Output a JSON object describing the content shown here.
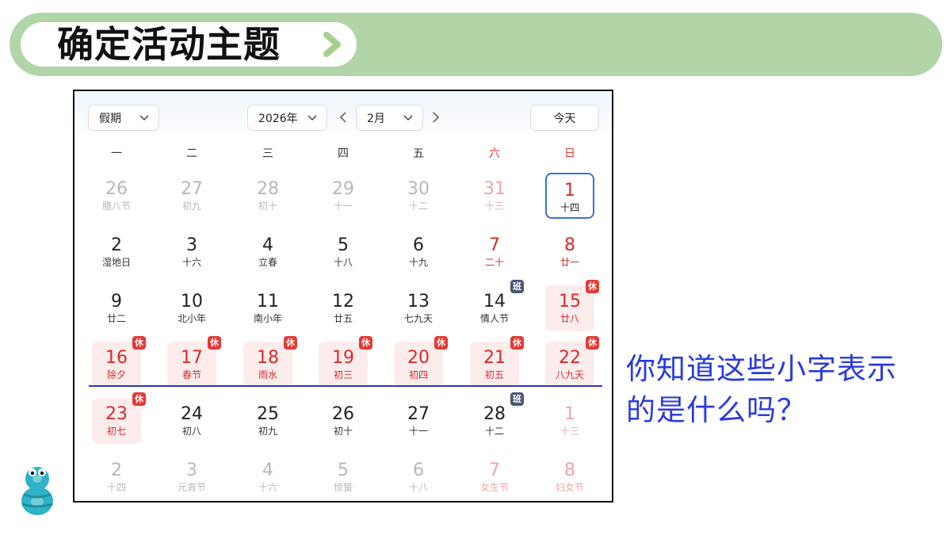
{
  "header": {
    "title": "确定活动主题"
  },
  "calendar": {
    "controls": {
      "holiday_label": "假期",
      "year_label": "2026年",
      "month_label": "2月",
      "today_label": "今天"
    },
    "weekdays": [
      "一",
      "二",
      "三",
      "四",
      "五",
      "六",
      "日"
    ],
    "days": [
      {
        "n": "26",
        "l": "腊八节",
        "dim": true
      },
      {
        "n": "27",
        "l": "初九",
        "dim": true
      },
      {
        "n": "28",
        "l": "初十",
        "dim": true
      },
      {
        "n": "29",
        "l": "十一",
        "dim": true
      },
      {
        "n": "30",
        "l": "十二",
        "dim": true
      },
      {
        "n": "31",
        "l": "十三",
        "dim": true,
        "red": true
      },
      {
        "n": "1",
        "l": "十四",
        "selected": true
      },
      {
        "n": "2",
        "l": "湿地日"
      },
      {
        "n": "3",
        "l": "十六"
      },
      {
        "n": "4",
        "l": "立春"
      },
      {
        "n": "5",
        "l": "十八"
      },
      {
        "n": "6",
        "l": "十九"
      },
      {
        "n": "7",
        "l": "二十",
        "red": true
      },
      {
        "n": "8",
        "l": "廿一",
        "red": true
      },
      {
        "n": "9",
        "l": "廿二"
      },
      {
        "n": "10",
        "l": "北小年"
      },
      {
        "n": "11",
        "l": "南小年"
      },
      {
        "n": "12",
        "l": "廿五"
      },
      {
        "n": "13",
        "l": "七九天"
      },
      {
        "n": "14",
        "l": "情人节",
        "badge": "班"
      },
      {
        "n": "15",
        "l": "廿八",
        "red": true,
        "rest": true,
        "badge": "休"
      },
      {
        "n": "16",
        "l": "除夕",
        "red": true,
        "rest": true,
        "badge": "休"
      },
      {
        "n": "17",
        "l": "春节",
        "red": true,
        "rest": true,
        "badge": "休"
      },
      {
        "n": "18",
        "l": "雨水",
        "red": true,
        "rest": true,
        "badge": "休"
      },
      {
        "n": "19",
        "l": "初三",
        "red": true,
        "rest": true,
        "badge": "休"
      },
      {
        "n": "20",
        "l": "初四",
        "red": true,
        "rest": true,
        "badge": "休"
      },
      {
        "n": "21",
        "l": "初五",
        "red": true,
        "rest": true,
        "badge": "休"
      },
      {
        "n": "22",
        "l": "八九天",
        "red": true,
        "rest": true,
        "badge": "休"
      },
      {
        "n": "23",
        "l": "初七",
        "red": true,
        "rest": true,
        "badge": "休"
      },
      {
        "n": "24",
        "l": "初八"
      },
      {
        "n": "25",
        "l": "初九"
      },
      {
        "n": "26",
        "l": "初十"
      },
      {
        "n": "27",
        "l": "十一"
      },
      {
        "n": "28",
        "l": "十二",
        "badge": "班"
      },
      {
        "n": "1",
        "l": "十三",
        "dim": true,
        "red": true
      },
      {
        "n": "2",
        "l": "十四",
        "dim": true
      },
      {
        "n": "3",
        "l": "元宵节",
        "dim": true
      },
      {
        "n": "4",
        "l": "十六",
        "dim": true
      },
      {
        "n": "5",
        "l": "惊蛰",
        "dim": true
      },
      {
        "n": "6",
        "l": "十八",
        "dim": true
      },
      {
        "n": "7",
        "l": "女生节",
        "dim": true,
        "red": true
      },
      {
        "n": "8",
        "l": "妇女节",
        "dim": true,
        "red": true
      }
    ]
  },
  "question": {
    "line1": "你知道这些小字表示",
    "line2": "的是什么吗？"
  },
  "colors": {
    "banner": "#b2d5a8",
    "accent_red": "#d52b2b",
    "rest_bg": "#fdecec",
    "work_badge": "#4a5578",
    "selected_border": "#3a6fd8",
    "question_text": "#2a3be0",
    "week_line": "#2a35c9"
  },
  "icons": {
    "banner": "chevron-right-icon",
    "dropdown": "chevron-down-icon",
    "prev": "chevron-left-icon",
    "next": "chevron-right-icon",
    "mascot": "number-eight-mascot-icon"
  }
}
